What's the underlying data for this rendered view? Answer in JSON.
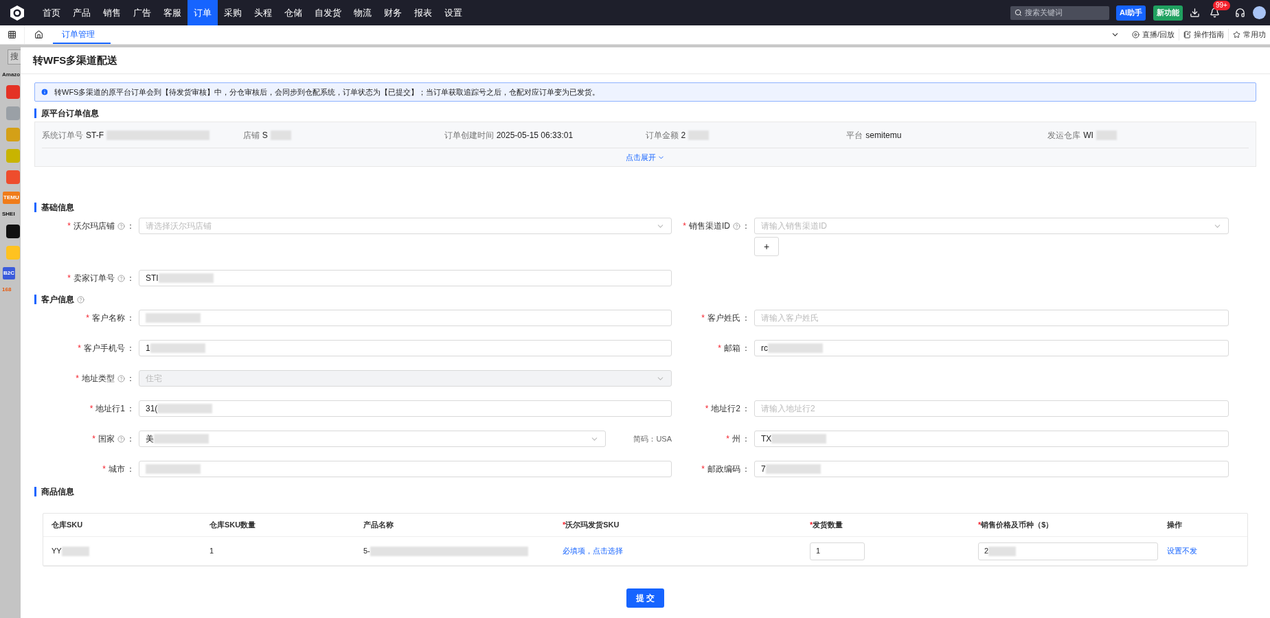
{
  "top_nav": {
    "items": [
      {
        "label": "首页",
        "selected": false
      },
      {
        "label": "产品",
        "selected": false
      },
      {
        "label": "销售",
        "selected": false
      },
      {
        "label": "广告",
        "selected": false
      },
      {
        "label": "客服",
        "selected": false
      },
      {
        "label": "订单",
        "selected": true
      },
      {
        "label": "采购",
        "selected": false
      },
      {
        "label": "头程",
        "selected": false
      },
      {
        "label": "仓储",
        "selected": false
      },
      {
        "label": "自发货",
        "selected": false
      },
      {
        "label": "物流",
        "selected": false
      },
      {
        "label": "财务",
        "selected": false
      },
      {
        "label": "报表",
        "selected": false
      },
      {
        "label": "设置",
        "selected": false
      }
    ],
    "search_placeholder": "搜索关键词",
    "ai_button": "AI助手",
    "new_button": "新功能",
    "notification_count": "99+"
  },
  "tab_bar": {
    "tabs": [
      {
        "label": "订单管理",
        "selected": true
      }
    ],
    "actions": [
      "直播/回放",
      "操作指南",
      "常用功"
    ]
  },
  "sidebar": {
    "search_placeholder": "搜",
    "logos": [
      {
        "kind": "text",
        "label": "Amazo",
        "color": "#222222"
      },
      {
        "kind": "icon",
        "color": "#e43225"
      },
      {
        "kind": "icon",
        "color": "#9aa0a6"
      },
      {
        "kind": "icon",
        "color": "#d4a017"
      },
      {
        "kind": "icon",
        "color": "#c8b400"
      },
      {
        "kind": "icon",
        "color": "#ee4d2d"
      },
      {
        "kind": "badge",
        "label": "TEMU",
        "color": "#f07c1a"
      },
      {
        "kind": "text",
        "label": "SHEI",
        "color": "#111111"
      },
      {
        "kind": "icon",
        "color": "#111111"
      },
      {
        "kind": "icon",
        "color": "#ffc220"
      },
      {
        "kind": "badge",
        "label": "B2C",
        "color": "#3b5bdb"
      },
      {
        "kind": "text",
        "label": "168",
        "color": "#e8590c"
      }
    ]
  },
  "dialog": {
    "title": "转WFS多渠道配送",
    "notice": "转WFS多渠道的原平台订单会到【待发货审核】中，分仓审核后，会同步到仓配系统，订单状态为【已提交】；当订单获取追踪号之后，仓配对应订单变为已发货。",
    "original_order": {
      "title": "原平台订单信息",
      "fields": [
        {
          "label": "系统订单号",
          "value": "ST-F"
        },
        {
          "label": "店铺",
          "value": "S"
        },
        {
          "label": "订单创建时间",
          "value": "2025-05-15 06:33:01"
        },
        {
          "label": "订单金额",
          "value": "2"
        },
        {
          "label": "平台",
          "value": "semitemu"
        },
        {
          "label": "发运仓库",
          "value": "WI"
        }
      ],
      "expand_link": "点击展开"
    },
    "basic_info": {
      "title": "基础信息",
      "help": false,
      "rows": [
        [
          {
            "mark": "*",
            "label": "沃尔玛店铺",
            "help": true,
            "colon": "：",
            "kind": "select",
            "placeholder": "请选择沃尔玛店铺"
          },
          {
            "mark": "*",
            "label": "销售渠道ID",
            "help": true,
            "colon": "：",
            "kind": "select",
            "placeholder": "请输入销售渠道ID",
            "add_button": "+"
          }
        ],
        [
          {
            "mark": "*",
            "label": "卖家订单号",
            "help": true,
            "colon": "：",
            "kind": "input",
            "value": "STI"
          }
        ]
      ]
    },
    "customer_info": {
      "title": "客户信息",
      "help": true,
      "rows": [
        [
          {
            "mark": "*",
            "label": "客户名称",
            "help": false,
            "colon": "：",
            "kind": "input"
          },
          {
            "mark": "*",
            "label": "客户姓氏",
            "help": false,
            "colon": "：",
            "kind": "input",
            "placeholder": "请输入客户姓氏"
          }
        ],
        [
          {
            "mark": "*",
            "label": "客户手机号",
            "help": false,
            "colon": "：",
            "kind": "input",
            "value": "1"
          },
          {
            "mark": "*",
            "label": "邮箱",
            "help": false,
            "colon": "：",
            "kind": "input",
            "value": "rc"
          }
        ],
        [
          {
            "mark": "*",
            "label": "地址类型",
            "help": true,
            "colon": "：",
            "kind": "select",
            "placeholder": "住宅",
            "disabled": true
          }
        ],
        [
          {
            "mark": "*",
            "label": "地址行1",
            "help": false,
            "colon": "：",
            "kind": "input",
            "value": "31("
          },
          {
            "mark": "*",
            "label": "地址行2",
            "help": false,
            "colon": "：",
            "kind": "input",
            "placeholder": "请输入地址行2"
          }
        ],
        [
          {
            "mark": "*",
            "label": "国家",
            "help": true,
            "colon": "：",
            "kind": "select",
            "value": "美",
            "note": "简码：USA"
          },
          {
            "mark": "*",
            "label": "州",
            "help": false,
            "colon": "：",
            "kind": "input",
            "value": "TX"
          }
        ],
        [
          {
            "mark": "*",
            "label": "城市",
            "help": false,
            "colon": "：",
            "kind": "input"
          },
          {
            "mark": "*",
            "label": "邮政编码",
            "help": false,
            "colon": "：",
            "kind": "input",
            "value": "7"
          }
        ]
      ]
    },
    "product_info": {
      "title": "商品信息",
      "columns": [
        {
          "label": "仓库SKU"
        },
        {
          "label": "仓库SKU数量"
        },
        {
          "label": "产品名称"
        },
        {
          "mark": "*",
          "label": "沃尔玛发货SKU"
        },
        {
          "mark": "*",
          "label": "发货数量"
        },
        {
          "mark": "*",
          "label": "销售价格及币种（$）"
        },
        {
          "label": "操作"
        }
      ],
      "rows": [
        [
          {
            "kind": "text",
            "text": "YY"
          },
          {
            "kind": "text",
            "text": "1"
          },
          {
            "kind": "text",
            "text": "5-"
          },
          {
            "kind": "link",
            "text": "必填项，点击选择"
          },
          {
            "kind": "input",
            "text": "1"
          },
          {
            "kind": "input",
            "text": "2"
          },
          {
            "kind": "link",
            "text": "设置不发"
          }
        ]
      ]
    },
    "submit_button": "提 交"
  }
}
